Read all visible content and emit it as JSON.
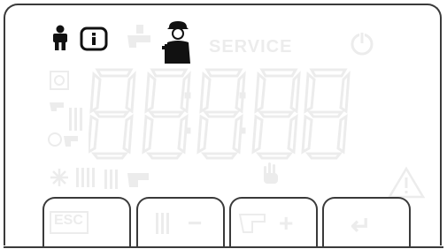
{
  "display": {
    "service_label": "SERVICE",
    "colors": {
      "active": "#111111",
      "inactive": "#ececec",
      "frame": "#3a3a3a"
    },
    "active_icons": [
      "person-icon",
      "info-icon",
      "technician-icon"
    ],
    "inactive_icons": [
      "tap-icon",
      "recycle-icon",
      "power-icon",
      "tap-radiator-icon",
      "flame-tap-icon",
      "snowflake-icon",
      "radiator-icon",
      "radiator-flame-icon",
      "hand-icon",
      "warning-icon"
    ]
  },
  "buttons": [
    {
      "label": "ESC"
    },
    {
      "label": "−"
    },
    {
      "label": "+"
    },
    {
      "label": "↵"
    }
  ]
}
